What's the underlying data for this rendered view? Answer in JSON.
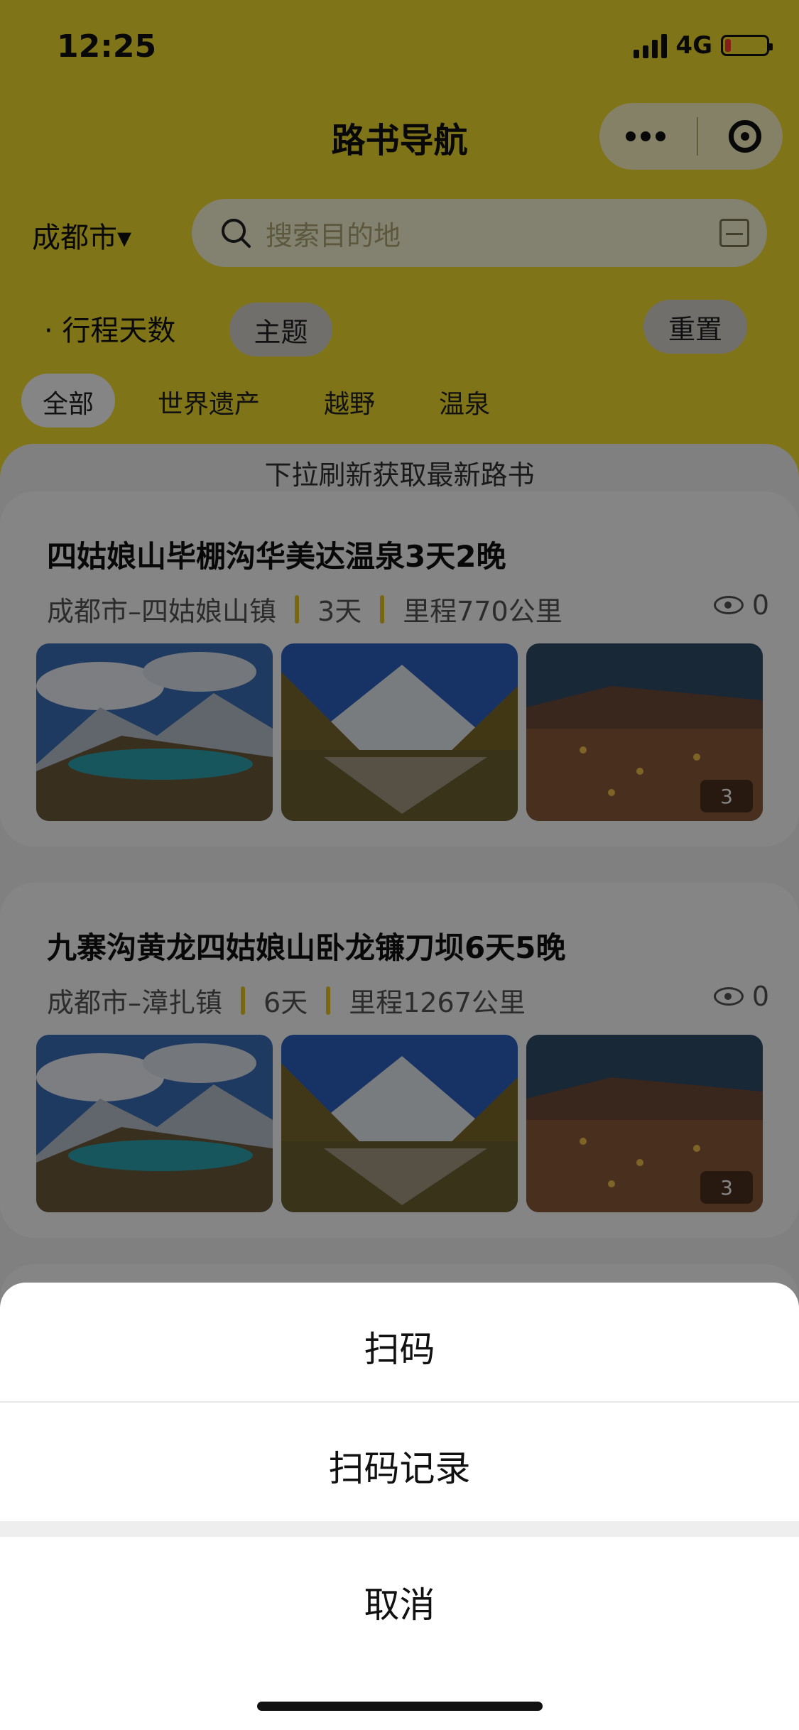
{
  "status_bar": {
    "time": "12:25",
    "network": "4G",
    "battery_level": 0.15
  },
  "header": {
    "title": "路书导航",
    "bg_color": "#f5df2e"
  },
  "capsule": {
    "more_icon": "more-icon",
    "close_icon": "target-icon"
  },
  "location": {
    "city": "成都市▾"
  },
  "search": {
    "placeholder": "搜索目的地",
    "icon": "search-icon",
    "scan_icon": "scan-icon"
  },
  "filters": {
    "days_label": "· 行程天数",
    "theme_label": "主题",
    "reset_label": "重置"
  },
  "tabs": [
    {
      "label": "全部",
      "active": true
    },
    {
      "label": "世界遗产",
      "active": false
    },
    {
      "label": "越野",
      "active": false
    },
    {
      "label": "温泉",
      "active": false
    }
  ],
  "refresh_tip": "下拉刷新获取最新路书",
  "cards": [
    {
      "title": "四姑娘山毕棚沟华美达温泉3天2晚",
      "route": "成都市–四姑娘山镇",
      "days": "3天",
      "distance": "里程770公里",
      "views": "0",
      "photo_count": "3"
    },
    {
      "title": "九寨沟黄龙四姑娘山卧龙镰刀坝6天5晚",
      "route": "成都市–漳扎镇",
      "days": "6天",
      "distance": "里程1267公里",
      "views": "0",
      "photo_count": "3"
    }
  ],
  "action_sheet": {
    "scan": "扫码",
    "scan_history": "扫码记录",
    "cancel": "取消"
  }
}
